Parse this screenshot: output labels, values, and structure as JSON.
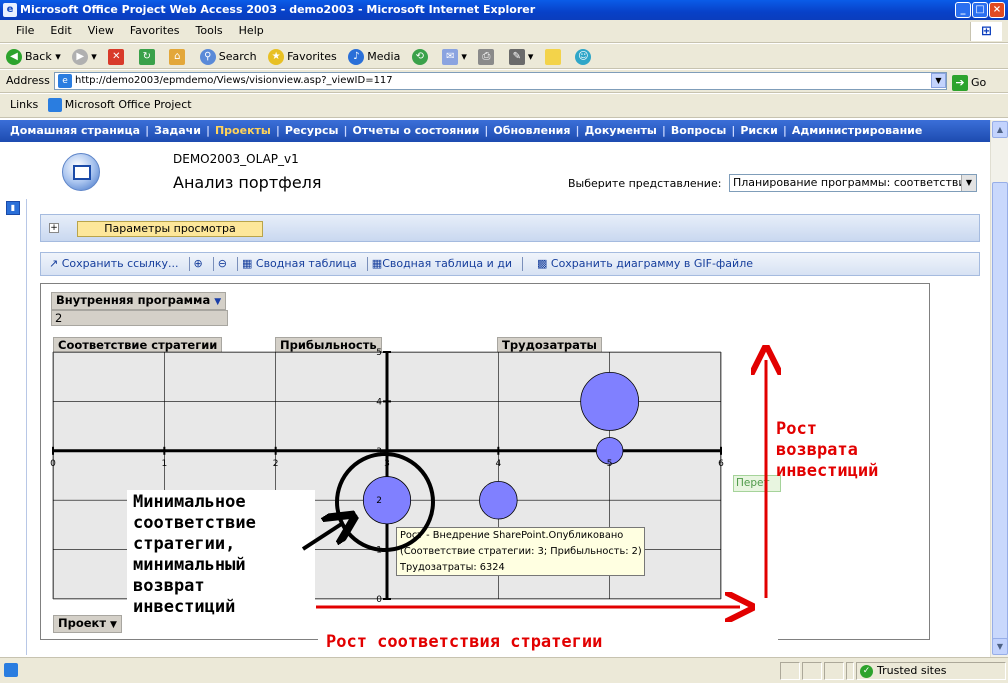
{
  "window": {
    "title": "Microsoft Office Project Web Access 2003 - demo2003 - Microsoft Internet Explorer"
  },
  "menu": [
    "File",
    "Edit",
    "View",
    "Favorites",
    "Tools",
    "Help"
  ],
  "toolbar": {
    "back": "Back",
    "search": "Search",
    "favorites": "Favorites",
    "media": "Media"
  },
  "address": {
    "label": "Address",
    "url": "http://demo2003/epmdemo/Views/visionview.asp?_viewID=117",
    "go": "Go"
  },
  "links": {
    "label": "Links",
    "item": "Microsoft Office Project"
  },
  "nav": {
    "items": [
      "Домашняя страница",
      "Задачи",
      "Проекты",
      "Ресурсы",
      "Отчеты о состоянии",
      "Обновления",
      "Документы",
      "Вопросы",
      "Риски",
      "Администрирование"
    ],
    "active_index": 2
  },
  "header": {
    "project": "DEMO2003_OLAP_v1",
    "title": "Анализ портфеля",
    "view_label": "Выберите представление:",
    "view_value": "Планирование программы: соответстви"
  },
  "params": {
    "button": "Параметры просмотра"
  },
  "tools": {
    "save_link": "Сохранить ссылку...",
    "pivot_table": "Сводная таблица",
    "pivot_chart": "Сводная таблица и ди",
    "save_gif": "Сохранить диаграмму в GIF-файле"
  },
  "fields": {
    "program": "Внутренняя программа",
    "program_value": "2",
    "x_field": "Соответствие стратегии",
    "y_field": "Прибыльность",
    "size_field": "Трудозатраты",
    "row_field": "Проект",
    "side_label": "Перет"
  },
  "tooltip": {
    "line1": "Рост - Внедрение SharePoint.Опубликовано",
    "line2": "(Соответствие стратегии: 3; Прибыльность: 2)",
    "line3": "Трудозатраты: 6324"
  },
  "annotations": {
    "left": [
      "Минимальное",
      "соответствие",
      "стратегии,",
      "минимальный",
      "возврат",
      "инвестиций"
    ],
    "right": [
      "Рост",
      "возврата",
      "инвестиций"
    ],
    "bottom": "Рост соответствия стратегии"
  },
  "chart_data": {
    "type": "scatter",
    "subtype": "bubble",
    "x_ticks": [
      0,
      1,
      2,
      3,
      4,
      5,
      6
    ],
    "y_ticks": [
      0,
      1,
      2,
      3,
      4,
      5
    ],
    "xlim": [
      0,
      6
    ],
    "ylim": [
      0,
      5
    ],
    "x_axis_crosses_y_at": 3,
    "y_axis_crosses_x_at": 3,
    "bubble_color": "#8080ff",
    "points": [
      {
        "x": 3,
        "y": 2,
        "size": 6324
      },
      {
        "x": 4,
        "y": 2,
        "size": 4000
      },
      {
        "x": 5,
        "y": 4,
        "size": 9500
      },
      {
        "x": 5,
        "y": 3,
        "size": 2000
      }
    ],
    "grid": true
  },
  "status": {
    "zone": "Trusted sites"
  }
}
